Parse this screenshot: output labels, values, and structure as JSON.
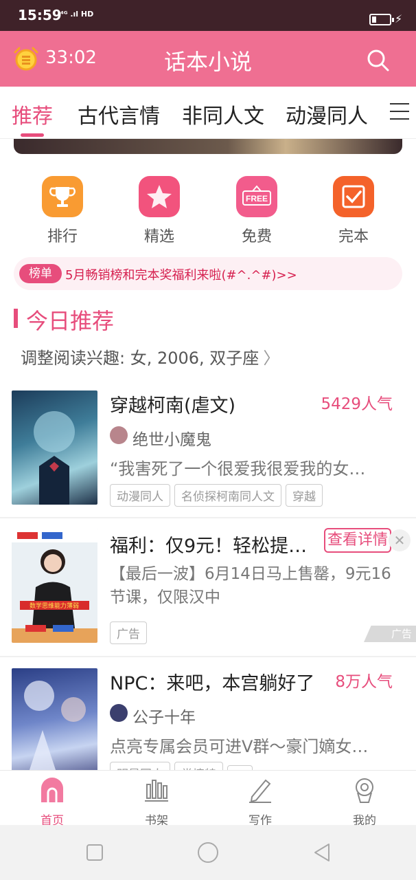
{
  "status_bar": {
    "time": "15:59",
    "network": "⁴ᴳ .ıl HD"
  },
  "app_bar": {
    "timer": "33:02",
    "title": "话本小说"
  },
  "tabs": [
    "推荐",
    "古代言情",
    "非同人文",
    "动漫同人"
  ],
  "quick_actions": [
    {
      "label": "排行",
      "icon": "trophy-icon",
      "color": "#f99b32"
    },
    {
      "label": "精选",
      "icon": "star-icon",
      "color": "#f2537d"
    },
    {
      "label": "免费",
      "icon": "free-icon",
      "color": "#f25c8c"
    },
    {
      "label": "完本",
      "icon": "check-icon",
      "color": "#f4622a"
    }
  ],
  "notice": {
    "badge": "榜单",
    "text": "5月畅销榜和完本奖福利来啦(#^.^#)>>"
  },
  "section": {
    "title": "今日推荐",
    "prefs": "调整阅读兴趣: 女, 2006, 双子座"
  },
  "books": [
    {
      "title": "穿越柯南(虐文)",
      "popularity": "5429人气",
      "author": "绝世小魔鬼",
      "description": "“我害死了一个很爱我很爱我的女…",
      "tags": [
        "动漫同人",
        "名侦探柯南同人文",
        "穿越"
      ]
    },
    {
      "title": "NPC：来吧，本宫躺好了",
      "popularity": "8万人气",
      "author": "公子十年",
      "description": "点亮专属会员可进V群～豪门嫡女…",
      "tags": [
        "明星同人",
        "常情特",
        "…"
      ]
    }
  ],
  "ad": {
    "title": "福利：仅9元！轻松提…",
    "detail_button": "查看详情",
    "description": "【最后一波】6月14日马上售罄，9元16节课，仅限汉中",
    "tag": "广告",
    "corner": "广告",
    "cover_caption": "数学思维能力薄弱"
  },
  "bottom_nav": [
    {
      "label": "首页",
      "active": true
    },
    {
      "label": "书架",
      "active": false
    },
    {
      "label": "写作",
      "active": false
    },
    {
      "label": "我的",
      "active": false
    }
  ],
  "accent_color": "#e74d7c"
}
